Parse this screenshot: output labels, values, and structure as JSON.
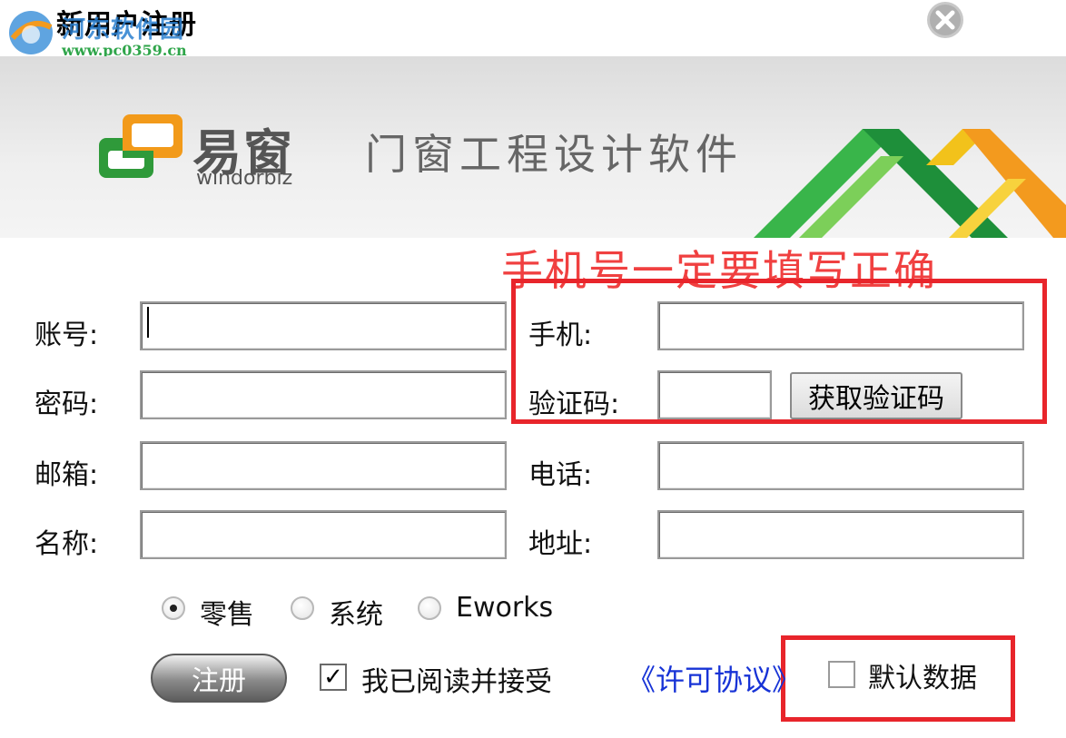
{
  "window": {
    "title": "新用户注册",
    "watermark_name": "河东软件园",
    "watermark_url": "www.pc0359.cn",
    "close_icon": "close-icon"
  },
  "banner": {
    "brand_cn": "易窗",
    "brand_en": "windorbiz",
    "product_name": "门窗工程设计软件"
  },
  "annotation": {
    "note": "手机号一定要填写正确",
    "color": "#e8252b"
  },
  "form": {
    "account_label": "账号:",
    "password_label": "密码:",
    "email_label": "邮箱:",
    "name_label": "名称:",
    "phone_label": "手机:",
    "code_label": "验证码:",
    "tel_label": "电话:",
    "address_label": "地址:",
    "account_value": "",
    "password_value": "",
    "email_value": "",
    "name_value": "",
    "phone_value": "",
    "code_value": "",
    "tel_value": "",
    "address_value": "",
    "get_code_button": "获取验证码"
  },
  "types": {
    "options": [
      "零售",
      "系统",
      "Eworks"
    ],
    "selected": "零售"
  },
  "footer": {
    "register_button": "注册",
    "agree_label": "我已阅读并接受",
    "agree_checked": true,
    "license_link": "《许可协议》",
    "default_data_label": "默认数据",
    "default_data_checked": false
  }
}
